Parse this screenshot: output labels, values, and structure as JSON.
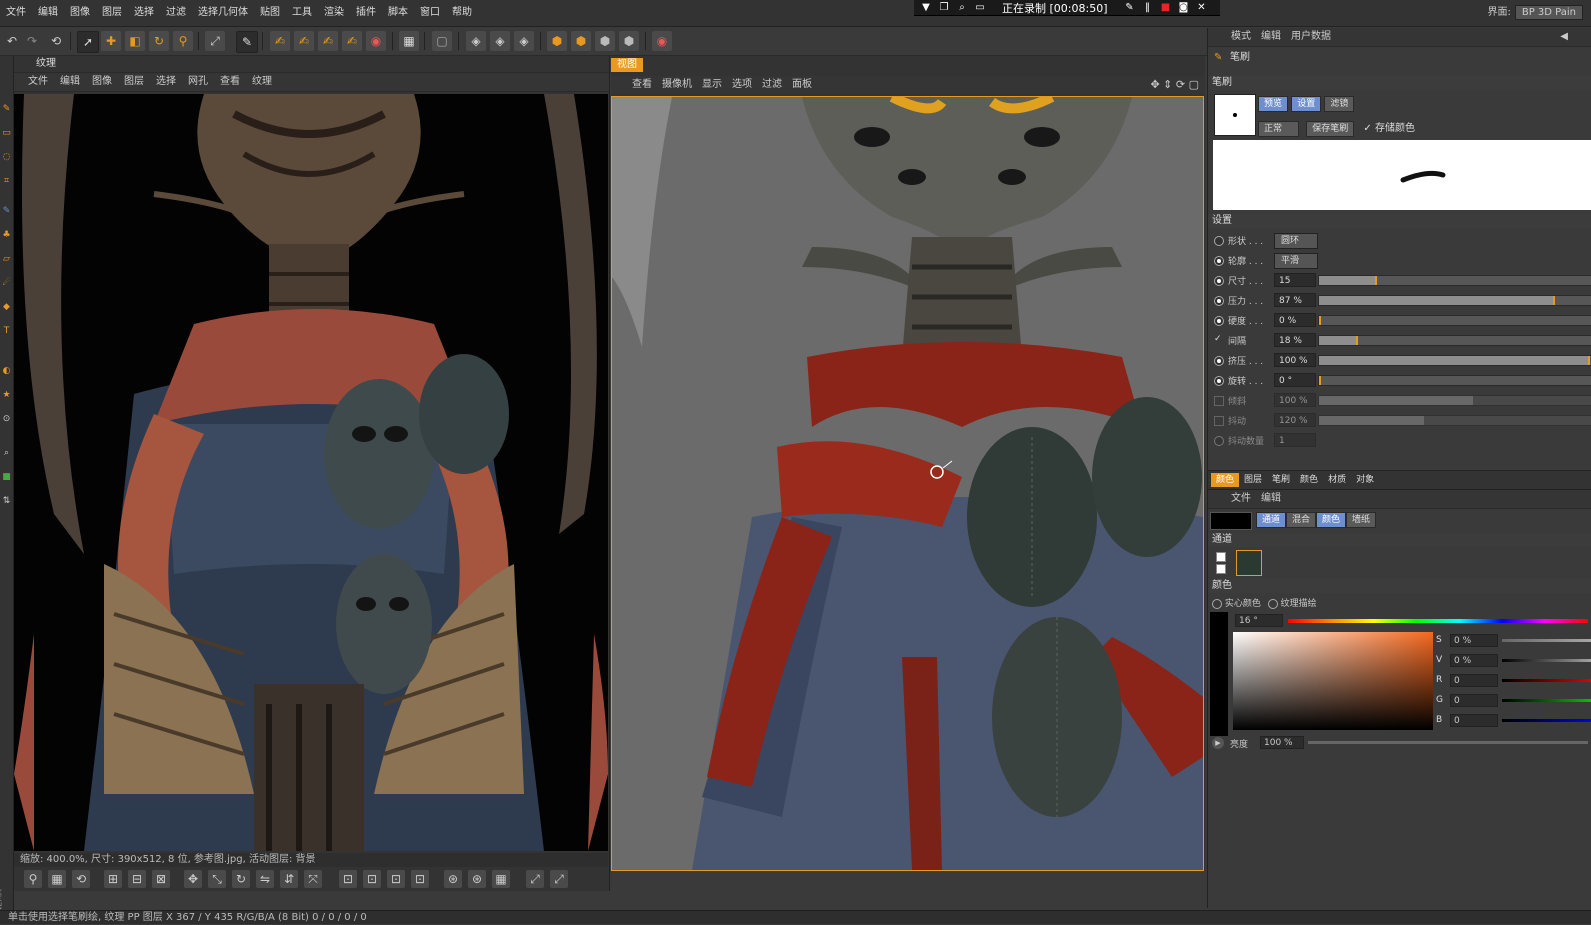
{
  "menubar": {
    "items": [
      "文件",
      "编辑",
      "图像",
      "图层",
      "选择",
      "过滤",
      "选择几何体",
      "贴图",
      "工具",
      "渲染",
      "插件",
      "脚本",
      "窗口",
      "帮助"
    ],
    "layout_label": "界面:",
    "layout_value": "BP 3D Pain"
  },
  "recording": {
    "status": "正在录制 [00:08:50]"
  },
  "texture_panel": {
    "title": "纹理",
    "menu": [
      "文件",
      "编辑",
      "图像",
      "图层",
      "选择",
      "网孔",
      "查看",
      "纹理"
    ],
    "status": "缩放: 400.0%, 尺寸: 390x512, 8 位, 参考图.jpg, 活动图层: 背景"
  },
  "viewport": {
    "tab": "视图",
    "menu": [
      "查看",
      "摄像机",
      "显示",
      "选项",
      "过滤",
      "面板"
    ]
  },
  "right_panel": {
    "top_tabs": [
      "模式",
      "编辑",
      "用户数据"
    ],
    "brush_header": "笔刷",
    "brush_section": "笔刷",
    "brush_tabs": [
      "预览",
      "设置",
      "滤镜"
    ],
    "mode_value": "正常",
    "save_brush": "保存笔刷",
    "store_color": "存储颜色",
    "settings_header": "设置",
    "shape": {
      "label": "形状 . . .",
      "value": "圆环"
    },
    "profile": {
      "label": "轮廓 . . .",
      "value": "平滑"
    },
    "params": [
      {
        "label": "尺寸 . . .",
        "value": "15",
        "level": 0.21,
        "dim": false
      },
      {
        "label": "压力 . . .",
        "value": "87 %",
        "level": 0.87,
        "dim": false
      },
      {
        "label": "硬度 . . .",
        "value": "0 %",
        "level": 0.0,
        "dim": false
      },
      {
        "label": "间隔",
        "value": "18 %",
        "level": 0.14,
        "dim": false
      },
      {
        "label": "挤压 . . .",
        "value": "100 %",
        "level": 1.0,
        "dim": false
      },
      {
        "label": "旋转 . . .",
        "value": "0 °",
        "level": 0.0,
        "dim": false
      },
      {
        "label": "倾斜",
        "value": "100 %",
        "level": 0.57,
        "dim": true
      },
      {
        "label": "抖动",
        "value": "120 %",
        "level": 0.39,
        "dim": true
      },
      {
        "label": "抖动数量",
        "value": "1",
        "level": 0.0,
        "dim": true
      }
    ],
    "bottom_tabs": [
      "颜色",
      "图层",
      "笔刷",
      "颜色",
      "材质",
      "对象"
    ],
    "sub_menu": [
      "文件",
      "编辑"
    ],
    "channel_tabs": [
      "通道",
      "混合",
      "颜色",
      "墙纸"
    ],
    "channels_header": "通道",
    "color_header": "颜色",
    "solid_color": "实心颜色",
    "texture_paint": "纹理描绘",
    "hue": "16 °",
    "color_fields": [
      {
        "label": "S",
        "value": "0 %"
      },
      {
        "label": "V",
        "value": "0 %"
      },
      {
        "label": "R",
        "value": "0"
      },
      {
        "label": "G",
        "value": "0"
      },
      {
        "label": "B",
        "value": "0"
      }
    ],
    "brightness_label": "亮度",
    "brightness_value": "100 %"
  },
  "statusbar": {
    "text": "单击使用选择笔刷绘, 纹理 PP 图层     X 367 / Y 435 R/G/B/A (8 Bit) 0 / 0 / 0 / 0"
  },
  "colors": {
    "accent": "#e89a20",
    "selected_tab": "#6d8fd0"
  }
}
